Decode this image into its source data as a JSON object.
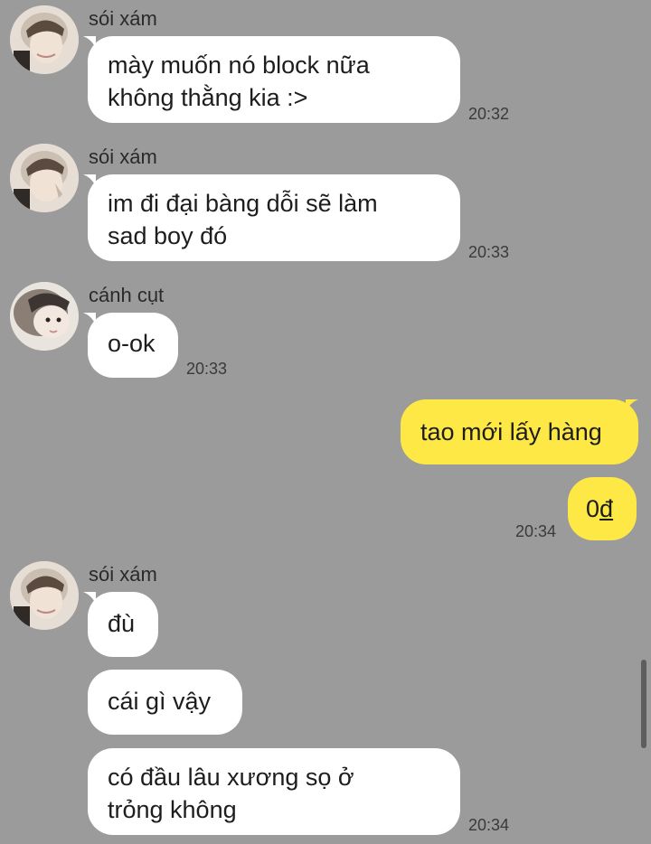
{
  "messages": {
    "m1": {
      "sender": "sói xám",
      "text_line1": "mày muốn nó block nữa",
      "text_line2": "không thằng kia :>",
      "time": "20:32"
    },
    "m2": {
      "sender": "sói xám",
      "text_line1": "im đi đại bàng dỗi sẽ làm",
      "text_line2": "sad boy đó",
      "time": "20:33"
    },
    "m3": {
      "sender": "cánh cụt",
      "text": "o-ok",
      "time": "20:33"
    },
    "m4": {
      "text": "tao mới lấy hàng"
    },
    "m5": {
      "text_prefix": "0",
      "text_suffix": "đ",
      "time": "20:34"
    },
    "m6": {
      "sender": "sói xám",
      "text": "đù"
    },
    "m7": {
      "text": "cái gì vậy"
    },
    "m8": {
      "text_line1": "có đầu lâu xương sọ ở",
      "text_line2": "trỏng không",
      "time": "20:34"
    }
  },
  "colors": {
    "background": "#9b9b9b",
    "incoming_bubble": "#ffffff",
    "outgoing_bubble": "#fde845"
  },
  "icons": {
    "avatar_1": "avatar-wolf-icon",
    "avatar_2": "avatar-penguin-icon"
  }
}
